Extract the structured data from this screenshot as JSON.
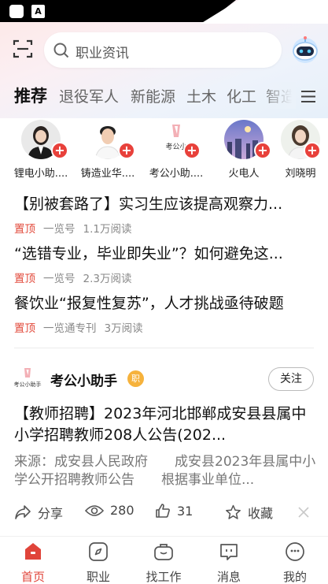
{
  "search": {
    "placeholder": "职业资讯"
  },
  "tabs": [
    {
      "label": "推荐"
    },
    {
      "label": "退役军人"
    },
    {
      "label": "新能源"
    },
    {
      "label": "土木"
    },
    {
      "label": "化工"
    },
    {
      "label": "智造"
    }
  ],
  "avatars": [
    {
      "name": "锂电小助...."
    },
    {
      "name": "铸造业华...."
    },
    {
      "name": "考公小助...."
    },
    {
      "name": "火电人"
    },
    {
      "name": "刘晓明"
    }
  ],
  "avatar_logo_text": "考公小",
  "headlines": [
    {
      "title": "【别被套路了】实习生应该提高观察力...",
      "pin": "置顶",
      "source": "一览号",
      "reads": "1.1万阅读"
    },
    {
      "title": "“选错专业，毕业即失业”？如何避免这...",
      "pin": "置顶",
      "source": "一览号",
      "reads": "2.3万阅读"
    },
    {
      "title": "餐饮业“报复性复苏”，人才挑战亟待破题",
      "pin": "置顶",
      "source": "一览通专刊",
      "reads": "3万阅读"
    }
  ],
  "card": {
    "logo_text": "考公小助手",
    "author": "考公小助手",
    "badge": "职",
    "follow_label": "关注",
    "title": "【教师招聘】2023年河北邯郸成安县县属中小学招聘教师208人公告(202...",
    "summary": "来源：成安县人民政府　　成安县2023年县属中小学公开招聘教师公告　　根据事业单位...",
    "share_label": "分享",
    "views": "280",
    "likes": "31",
    "collect_label": "收藏"
  },
  "nav": [
    {
      "label": "首页",
      "active": true
    },
    {
      "label": "职业"
    },
    {
      "label": "找工作"
    },
    {
      "label": "消息"
    },
    {
      "label": "我的"
    }
  ],
  "colors": {
    "accent": "#e0443a",
    "pin": "#e24a3b",
    "badge": "#f6b23c"
  }
}
